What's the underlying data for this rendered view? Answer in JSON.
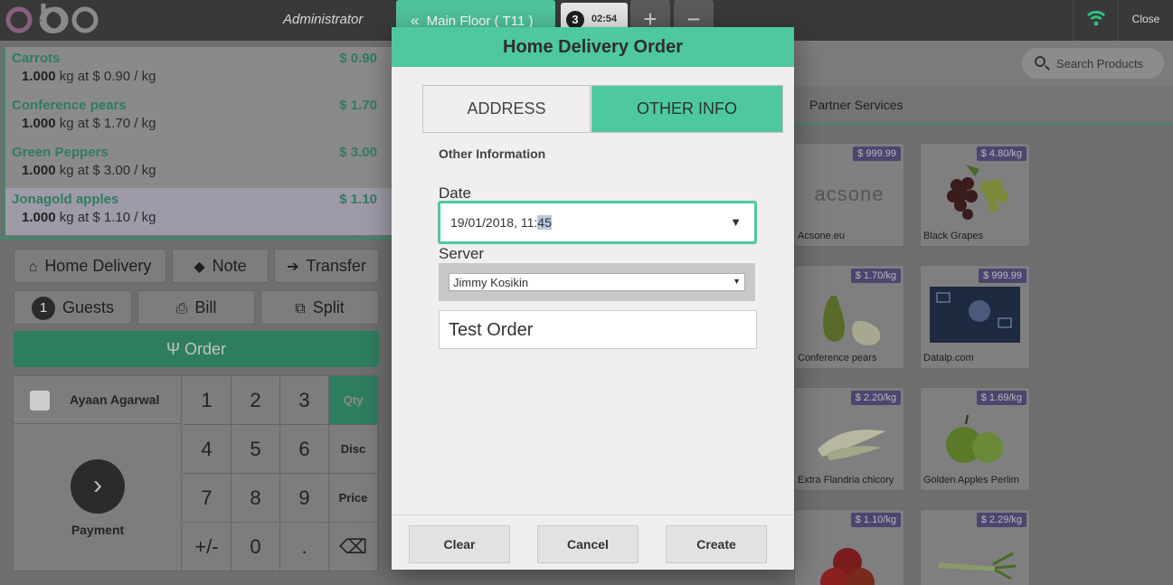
{
  "header": {
    "logo_text": "odoo",
    "cashier": "Administrator",
    "floor_label": "Main Floor ( T11 )",
    "order_tab": {
      "number": "3",
      "time": "02:54"
    },
    "add_label": "+",
    "remove_label": "−",
    "close_label": "Close"
  },
  "orderlines": [
    {
      "product": "Carrots",
      "price": "$ 0.90",
      "qty": "1.000",
      "detail": "kg at $ 0.90 / kg"
    },
    {
      "product": "Conference pears",
      "price": "$ 1.70",
      "qty": "1.000",
      "detail": "kg at $ 1.70 / kg"
    },
    {
      "product": "Green Peppers",
      "price": "$ 3.00",
      "qty": "1.000",
      "detail": "kg at $ 3.00 / kg"
    },
    {
      "product": "Jonagold apples",
      "price": "$ 1.10",
      "qty": "1.000",
      "detail": "kg at $ 1.10 / kg"
    }
  ],
  "controls": {
    "home_delivery": "Home Delivery",
    "note": "Note",
    "transfer": "Transfer",
    "guests_count": "1",
    "guests": "Guests",
    "bill": "Bill",
    "split": "Split",
    "order": "Order"
  },
  "numpad": {
    "customer": "Ayaan Agarwal",
    "payment": "Payment",
    "keys": [
      "1",
      "2",
      "3",
      "4",
      "5",
      "6",
      "7",
      "8",
      "9",
      "+/-",
      "0",
      "."
    ],
    "qty": "Qty",
    "disc": "Disc",
    "price": "Price",
    "backspace": "⌫"
  },
  "products_panel": {
    "search_placeholder": "Search Products",
    "category": "Partner Services",
    "products": [
      {
        "name": "Acsone.eu",
        "price": "$ 999.99"
      },
      {
        "name": "Black Grapes",
        "price": "$ 4.80/kg"
      },
      {
        "name": "Conference pears",
        "price": "$ 1.70/kg"
      },
      {
        "name": "Datalp.com",
        "price": "$ 999.99"
      },
      {
        "name": "Extra Flandria chicory",
        "price": "$ 2.20/kg"
      },
      {
        "name": "Golden Apples Perlim",
        "price": "$ 1.69/kg"
      },
      {
        "name": "",
        "price": "$ 1.10/kg"
      },
      {
        "name": "",
        "price": "$ 2.29/kg"
      }
    ],
    "acsone_logo": "acsone"
  },
  "modal": {
    "title": "Home Delivery Order",
    "tabs": [
      "ADDRESS",
      "OTHER INFO"
    ],
    "section_title": "Other Information",
    "date_label": "Date",
    "date_value_prefix": "19/01/2018, 11:",
    "date_value_selected": "45",
    "server_label": "Server",
    "server_value": "Jimmy Kosikin",
    "note_value": "Test Order",
    "buttons": {
      "clear": "Clear",
      "cancel": "Cancel",
      "create": "Create"
    }
  },
  "colors": {
    "accent": "#4ec99f",
    "dark_green": "#2f7d5f",
    "topbar": "#393939",
    "price_tag": "#4b4670"
  }
}
